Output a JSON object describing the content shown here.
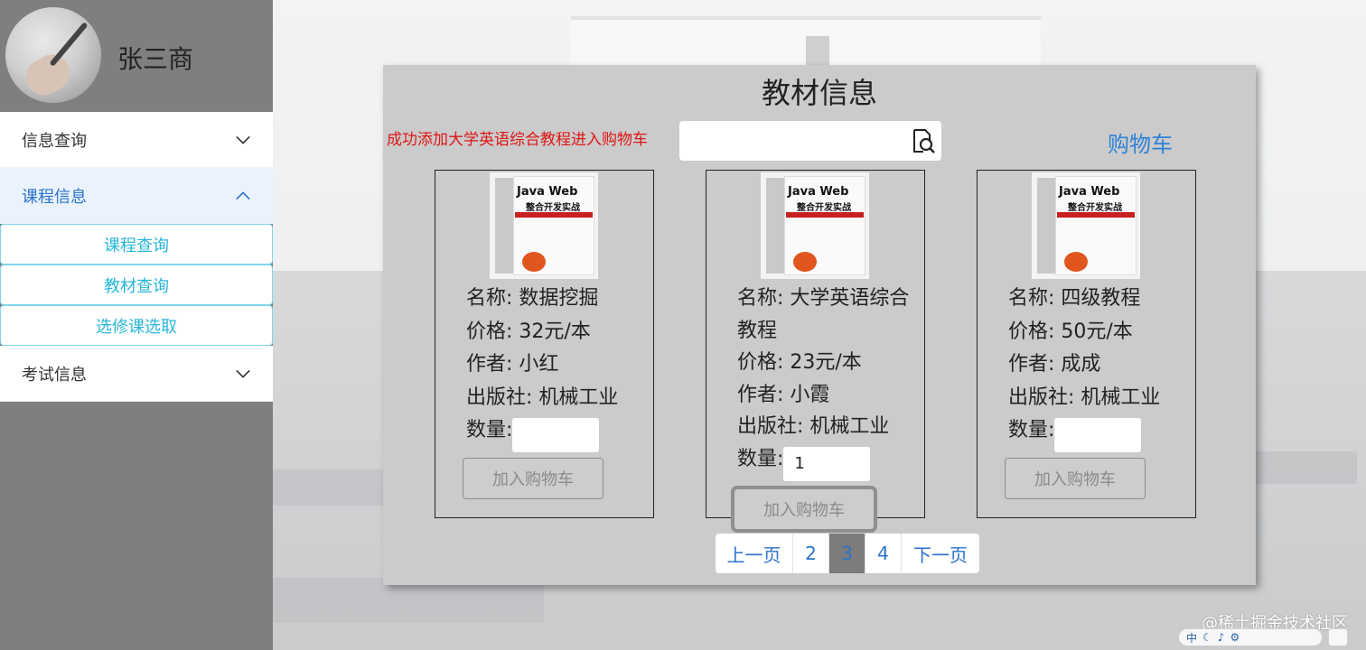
{
  "user": {
    "name": "张三商"
  },
  "menu": {
    "items": [
      {
        "label": "信息查询",
        "expanded": false
      },
      {
        "label": "课程信息",
        "expanded": true,
        "sub": [
          "课程查询",
          "教材查询",
          "选修课选取"
        ]
      },
      {
        "label": "考试信息",
        "expanded": false
      }
    ]
  },
  "panel": {
    "title": "教材信息",
    "message": "成功添加大学英语综合教程进入购物车",
    "search": {
      "placeholder": "",
      "value": ""
    },
    "cart_label": "购物车"
  },
  "books": [
    {
      "cover_title": "Java Web",
      "cover_subtitle": "整合开发实战",
      "name_label": "名称: 数据挖掘",
      "price_label": "价格: 32元/本",
      "author_label": "作者: 小红",
      "publisher_label": "出版社: 机械工业",
      "qty_label": "数量:",
      "qty_value": "",
      "button": "加入购物车"
    },
    {
      "cover_title": "Java Web",
      "cover_subtitle": "整合开发实战",
      "name_label": "名称: 大学英语综合教程",
      "price_label": "价格: 23元/本",
      "author_label": "作者: 小霞",
      "publisher_label": "出版社: 机械工业",
      "qty_label": "数量:",
      "qty_value": "1",
      "button": "加入购物车"
    },
    {
      "cover_title": "Java Web",
      "cover_subtitle": "整合开发实战",
      "name_label": "名称: 四级教程",
      "price_label": "价格: 50元/本",
      "author_label": "作者: 成成",
      "publisher_label": "出版社: 机械工业",
      "qty_label": "数量:",
      "qty_value": "",
      "button": "加入购物车"
    }
  ],
  "pagination": {
    "prev": "上一页",
    "pages": [
      "2",
      "3",
      "4"
    ],
    "current": "3",
    "next": "下一页"
  },
  "watermark": "@稀土掘金技术社区",
  "ime": {
    "label": "中"
  },
  "colors": {
    "sidebar": "#7f7f7f",
    "panel": "#cbcbcb",
    "accent": "#2a73c9",
    "message": "#e01515",
    "subitem": "#28b6d8"
  }
}
